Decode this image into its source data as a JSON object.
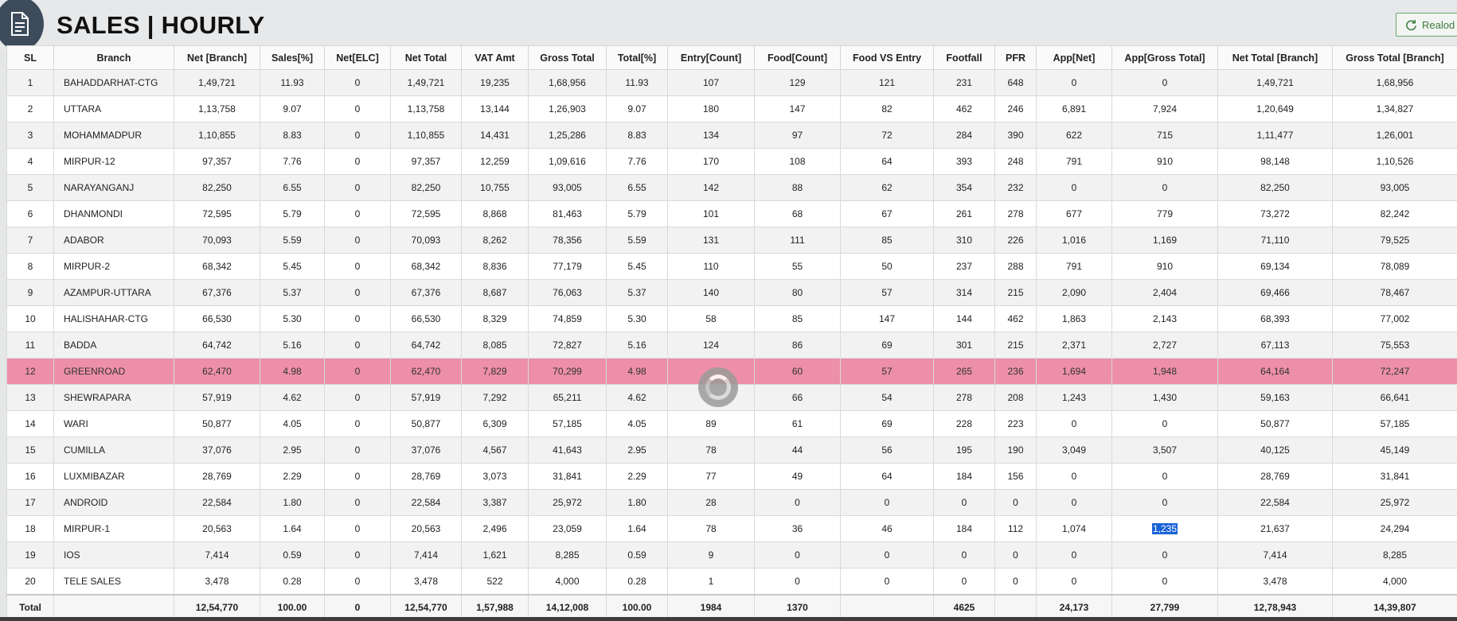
{
  "header": {
    "title": "SALES | HOURLY",
    "logo_icon": "document-icon",
    "reload_label": "Realod",
    "reload_icon": "refresh-icon"
  },
  "table": {
    "columns": [
      "SL",
      "Branch",
      "Net [Branch]",
      "Sales[%]",
      "Net[ELC]",
      "Net Total",
      "VAT Amt",
      "Gross Total",
      "Total[%]",
      "Entry[Count]",
      "Food[Count]",
      "Food VS Entry",
      "Footfall",
      "PFR",
      "App[Net]",
      "App[Gross Total]",
      "Net Total [Branch]",
      "Gross Total [Branch]"
    ],
    "rows": [
      [
        "1",
        "BAHADDARHAT-CTG",
        "1,49,721",
        "11.93",
        "0",
        "1,49,721",
        "19,235",
        "1,68,956",
        "11.93",
        "107",
        "129",
        "121",
        "231",
        "648",
        "0",
        "0",
        "1,49,721",
        "1,68,956"
      ],
      [
        "2",
        "UTTARA",
        "1,13,758",
        "9.07",
        "0",
        "1,13,758",
        "13,144",
        "1,26,903",
        "9.07",
        "180",
        "147",
        "82",
        "462",
        "246",
        "6,891",
        "7,924",
        "1,20,649",
        "1,34,827"
      ],
      [
        "3",
        "MOHAMMADPUR",
        "1,10,855",
        "8.83",
        "0",
        "1,10,855",
        "14,431",
        "1,25,286",
        "8.83",
        "134",
        "97",
        "72",
        "284",
        "390",
        "622",
        "715",
        "1,11,477",
        "1,26,001"
      ],
      [
        "4",
        "MIRPUR-12",
        "97,357",
        "7.76",
        "0",
        "97,357",
        "12,259",
        "1,09,616",
        "7.76",
        "170",
        "108",
        "64",
        "393",
        "248",
        "791",
        "910",
        "98,148",
        "1,10,526"
      ],
      [
        "5",
        "NARAYANGANJ",
        "82,250",
        "6.55",
        "0",
        "82,250",
        "10,755",
        "93,005",
        "6.55",
        "142",
        "88",
        "62",
        "354",
        "232",
        "0",
        "0",
        "82,250",
        "93,005"
      ],
      [
        "6",
        "DHANMONDI",
        "72,595",
        "5.79",
        "0",
        "72,595",
        "8,868",
        "81,463",
        "5.79",
        "101",
        "68",
        "67",
        "261",
        "278",
        "677",
        "779",
        "73,272",
        "82,242"
      ],
      [
        "7",
        "ADABOR",
        "70,093",
        "5.59",
        "0",
        "70,093",
        "8,262",
        "78,356",
        "5.59",
        "131",
        "111",
        "85",
        "310",
        "226",
        "1,016",
        "1,169",
        "71,110",
        "79,525"
      ],
      [
        "8",
        "MIRPUR-2",
        "68,342",
        "5.45",
        "0",
        "68,342",
        "8,836",
        "77,179",
        "5.45",
        "110",
        "55",
        "50",
        "237",
        "288",
        "791",
        "910",
        "69,134",
        "78,089"
      ],
      [
        "9",
        "AZAMPUR-UTTARA",
        "67,376",
        "5.37",
        "0",
        "67,376",
        "8,687",
        "76,063",
        "5.37",
        "140",
        "80",
        "57",
        "314",
        "215",
        "2,090",
        "2,404",
        "69,466",
        "78,467"
      ],
      [
        "10",
        "HALISHAHAR-CTG",
        "66,530",
        "5.30",
        "0",
        "66,530",
        "8,329",
        "74,859",
        "5.30",
        "58",
        "85",
        "147",
        "144",
        "462",
        "1,863",
        "2,143",
        "68,393",
        "77,002"
      ],
      [
        "11",
        "BADDA",
        "64,742",
        "5.16",
        "0",
        "64,742",
        "8,085",
        "72,827",
        "5.16",
        "124",
        "86",
        "69",
        "301",
        "215",
        "2,371",
        "2,727",
        "67,113",
        "75,553"
      ],
      [
        "12",
        "GREENROAD",
        "62,470",
        "4.98",
        "0",
        "62,470",
        "7,829",
        "70,299",
        "4.98",
        "",
        "60",
        "57",
        "265",
        "236",
        "1,694",
        "1,948",
        "64,164",
        "72,247"
      ],
      [
        "13",
        "SHEWRAPARA",
        "57,919",
        "4.62",
        "0",
        "57,919",
        "7,292",
        "65,211",
        "4.62",
        "",
        "66",
        "54",
        "278",
        "208",
        "1,243",
        "1,430",
        "59,163",
        "66,641"
      ],
      [
        "14",
        "WARI",
        "50,877",
        "4.05",
        "0",
        "50,877",
        "6,309",
        "57,185",
        "4.05",
        "89",
        "61",
        "69",
        "228",
        "223",
        "0",
        "0",
        "50,877",
        "57,185"
      ],
      [
        "15",
        "CUMILLA",
        "37,076",
        "2.95",
        "0",
        "37,076",
        "4,567",
        "41,643",
        "2.95",
        "78",
        "44",
        "56",
        "195",
        "190",
        "3,049",
        "3,507",
        "40,125",
        "45,149"
      ],
      [
        "16",
        "LUXMIBAZAR",
        "28,769",
        "2.29",
        "0",
        "28,769",
        "3,073",
        "31,841",
        "2.29",
        "77",
        "49",
        "64",
        "184",
        "156",
        "0",
        "0",
        "28,769",
        "31,841"
      ],
      [
        "17",
        "ANDROID",
        "22,584",
        "1.80",
        "0",
        "22,584",
        "3,387",
        "25,972",
        "1.80",
        "28",
        "0",
        "0",
        "0",
        "0",
        "0",
        "0",
        "22,584",
        "25,972"
      ],
      [
        "18",
        "MIRPUR-1",
        "20,563",
        "1.64",
        "0",
        "20,563",
        "2,496",
        "23,059",
        "1.64",
        "78",
        "36",
        "46",
        "184",
        "112",
        "1,074",
        "1,235",
        "21,637",
        "24,294"
      ],
      [
        "19",
        "IOS",
        "7,414",
        "0.59",
        "0",
        "7,414",
        "1,621",
        "8,285",
        "0.59",
        "9",
        "0",
        "0",
        "0",
        "0",
        "0",
        "0",
        "7,414",
        "8,285"
      ],
      [
        "20",
        "TELE SALES",
        "3,478",
        "0.28",
        "0",
        "3,478",
        "522",
        "4,000",
        "0.28",
        "1",
        "0",
        "0",
        "0",
        "0",
        "0",
        "0",
        "3,478",
        "4,000"
      ]
    ],
    "selected_row_index": 11,
    "highlighted_cell_text": "1,235",
    "total": [
      "Total",
      "",
      "12,54,770",
      "100.00",
      "0",
      "12,54,770",
      "1,57,988",
      "14,12,008",
      "100.00",
      "1984",
      "1370",
      "",
      "4625",
      "",
      "24,173",
      "27,799",
      "12,78,943",
      "14,39,807"
    ]
  },
  "colors": {
    "selected_row": "#ec8fa7",
    "text_selection": "#1a63d6",
    "logo_bg": "#3d4b5b",
    "reload_border": "#6aa26a"
  },
  "overlay": {
    "spinner_icon": "loading-spinner-icon"
  }
}
